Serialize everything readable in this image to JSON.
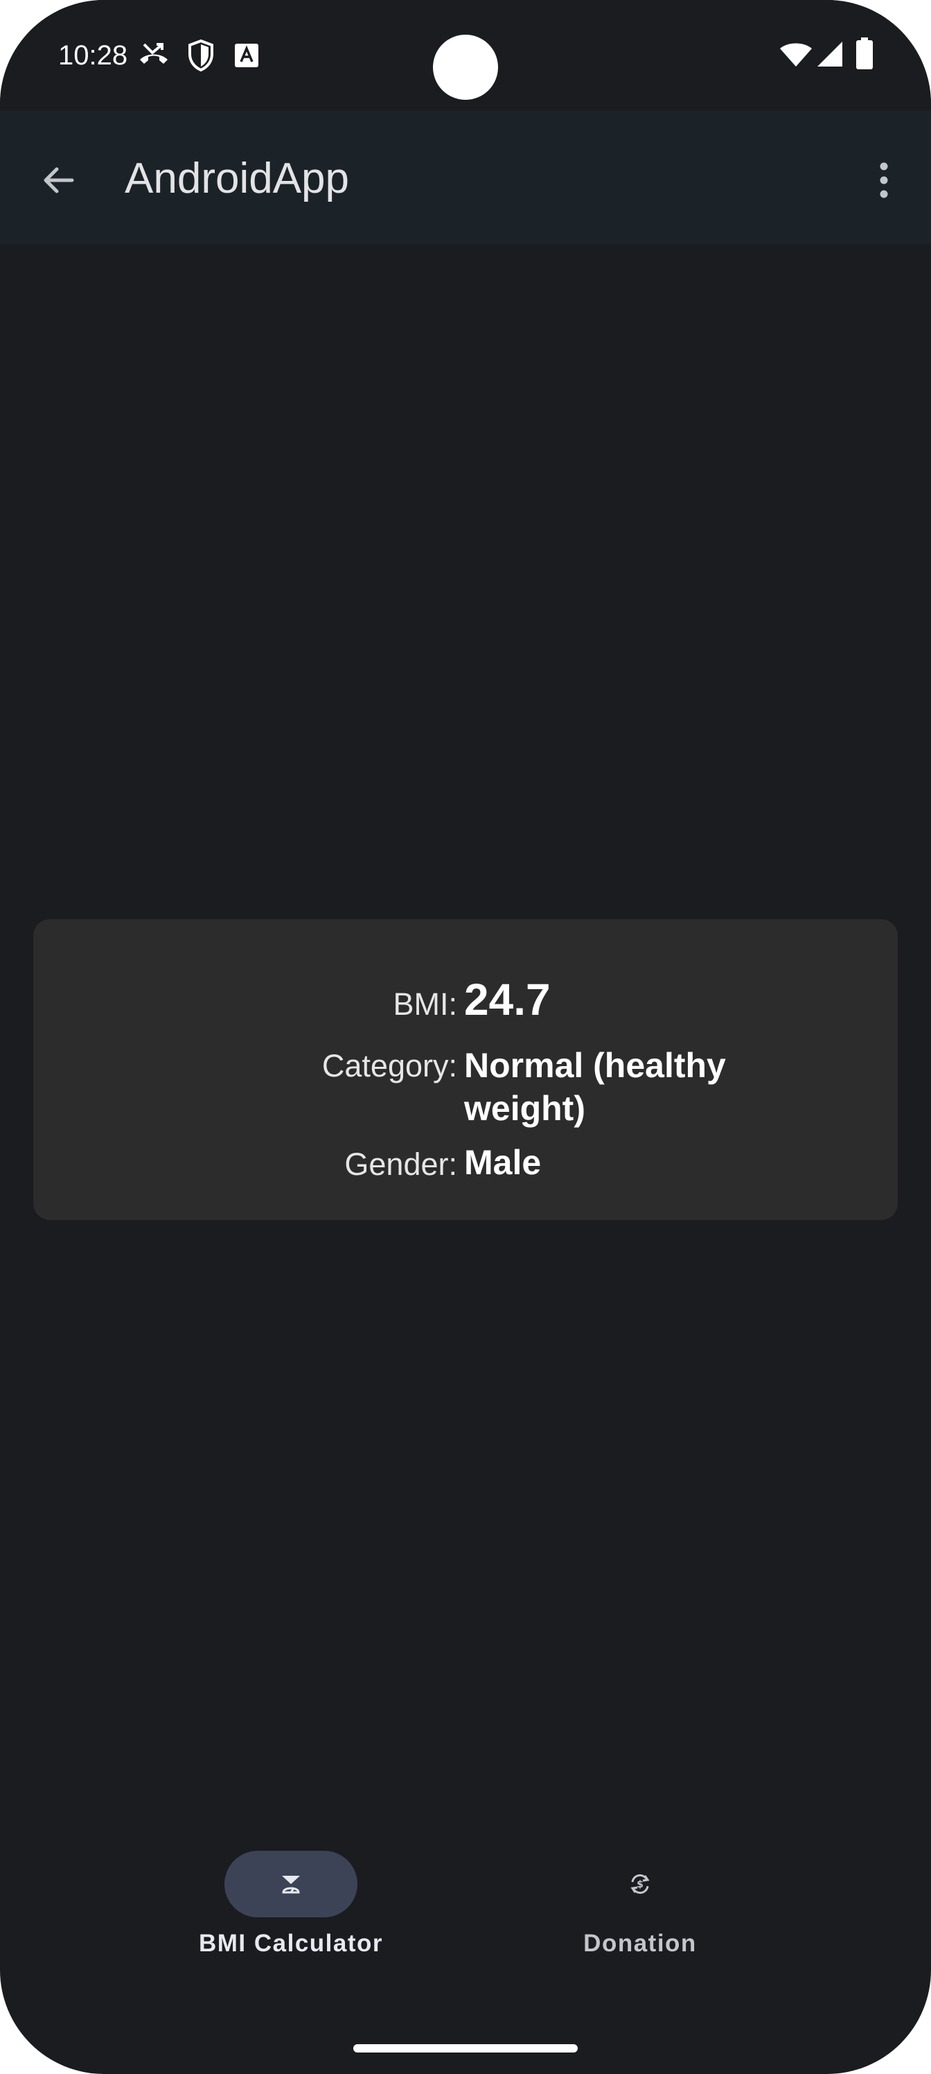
{
  "status_bar": {
    "time": "10:28",
    "icons_left": [
      "missed-call-icon",
      "shield-icon",
      "font-a-icon"
    ],
    "icons_right": [
      "wifi-icon",
      "cell-signal-icon",
      "battery-icon"
    ]
  },
  "app_bar": {
    "title": "AndroidApp",
    "back_icon": "arrow-back-icon",
    "menu_icon": "more-vert-icon"
  },
  "result": {
    "bmi_label": "BMI:",
    "bmi_value": "24.7",
    "category_label": "Category:",
    "category_value_line1": "Normal (healthy",
    "category_value_line2": "weight)",
    "gender_label": "Gender:",
    "gender_value": "Male"
  },
  "bottom_nav": {
    "items": [
      {
        "label": "BMI Calculator",
        "icon": "scale-icon",
        "selected": true
      },
      {
        "label": "Donation",
        "icon": "currency-exchange-icon",
        "selected": false
      }
    ]
  },
  "colors": {
    "background": "#1b1c20",
    "app_bar": "#1b2328",
    "card": "#2c2c2c",
    "nav_active_pill": "#3d4356",
    "text_primary": "#ffffff"
  }
}
